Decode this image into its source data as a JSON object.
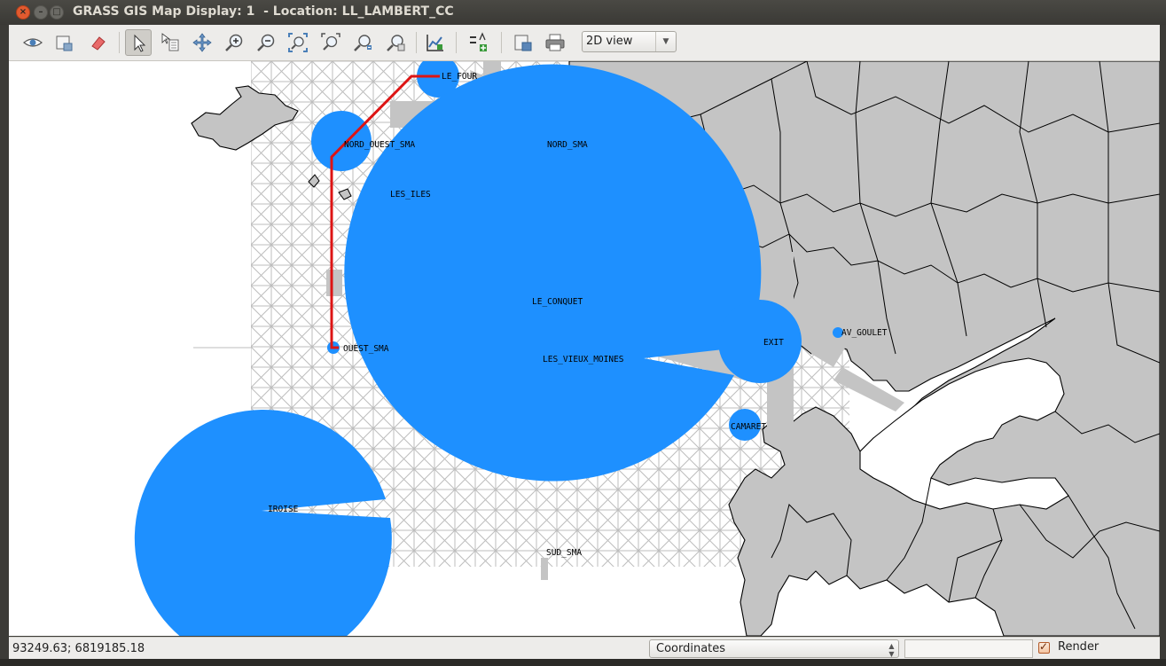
{
  "window": {
    "title": "GRASS GIS Map Display: 1  - Location: LL_LAMBERT_CC",
    "close_glyph": "×",
    "minimize_glyph": "–",
    "maximize_glyph": "□"
  },
  "toolbar": {
    "tools": [
      {
        "name": "display-map-icon",
        "tooltip": "Display map"
      },
      {
        "name": "render-map-icon",
        "tooltip": "Render map"
      },
      {
        "name": "erase-icon",
        "tooltip": "Erase display"
      },
      {
        "name": "pointer-icon",
        "tooltip": "Pointer",
        "active": true
      },
      {
        "name": "query-icon",
        "tooltip": "Query raster/vector map(s)"
      },
      {
        "name": "pan-icon",
        "tooltip": "Pan"
      },
      {
        "name": "zoom-in-icon",
        "tooltip": "Zoom in"
      },
      {
        "name": "zoom-out-icon",
        "tooltip": "Zoom out"
      },
      {
        "name": "zoom-extent-icon",
        "tooltip": "Zoom to selected map layer(s)"
      },
      {
        "name": "zoom-menu-icon",
        "tooltip": "Zoom options"
      },
      {
        "name": "zoom-back-icon",
        "tooltip": "Return to previous zoom"
      },
      {
        "name": "zoom-region-icon",
        "tooltip": "Zoom to computational region"
      },
      {
        "name": "analyze-icon",
        "tooltip": "Analyze map"
      },
      {
        "name": "overlay-icon",
        "tooltip": "Add map elements"
      },
      {
        "name": "save-image-icon",
        "tooltip": "Save display to graphic file"
      },
      {
        "name": "print-icon",
        "tooltip": "Print display"
      }
    ],
    "view_mode": "2D view"
  },
  "map": {
    "colors": {
      "land": "#c4c4c4",
      "border": "#000000",
      "grid": "#bdbdbd",
      "node": "#1e90ff",
      "route": "#dd1414",
      "sea": "#ffffff"
    },
    "labels": {
      "le_four": "LE_FOUR",
      "nord_ouest_sma": "NORD_OUEST_SMA",
      "nord_sma": "NORD_SMA",
      "les_iles": "LES_ILES",
      "le_conquet": "LE_CONQUET",
      "ouest_sma": "OUEST_SMA",
      "les_vieux_moines": "LES_VIEUX_MOINES",
      "exit": "EXIT",
      "av_goulet": "AV_GOULET",
      "camaret": "CAMARET",
      "iroise": "IROISE",
      "sud_sma": "SUD_SMA"
    }
  },
  "statusbar": {
    "coordinates": "93249.63; 6819185.18",
    "display_mode": "Coordinates",
    "render_label": "Render",
    "render_checked": true,
    "check_glyph": "✓",
    "spin_glyph": "▲▼"
  }
}
